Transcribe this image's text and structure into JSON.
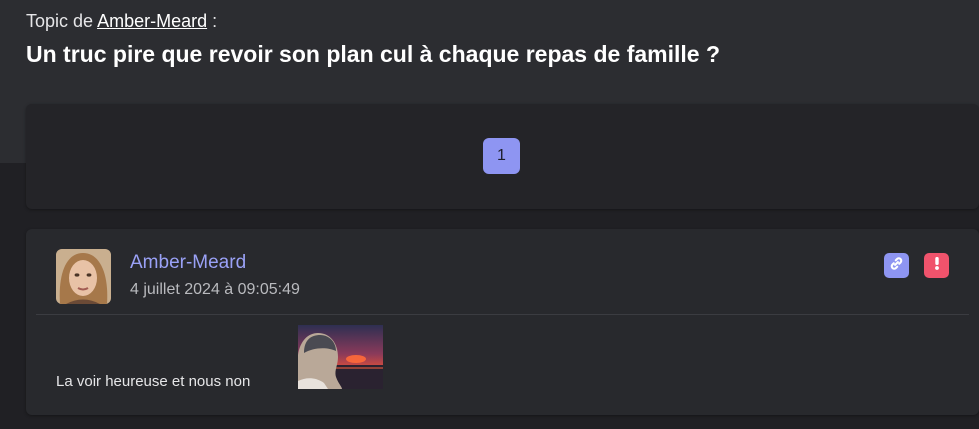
{
  "topic": {
    "prefix": "Topic de",
    "author_link": "Amber-Meard",
    "suffix": ":",
    "title": "Un truc pire que revoir son plan cul à chaque repas de famille ?"
  },
  "pagination": {
    "current_page": "1"
  },
  "post": {
    "author": "Amber-Meard",
    "date": "4 juillet 2024 à 09:05:49",
    "body_text": "La voir heureuse et nous non",
    "actions": {
      "permalink_icon": "link-icon",
      "report_icon": "alert-icon"
    }
  },
  "colors": {
    "accent": "#8e95f2",
    "danger": "#f0536c",
    "background": "#202024",
    "header_band": "#2c2d31",
    "card": "#28292d"
  }
}
